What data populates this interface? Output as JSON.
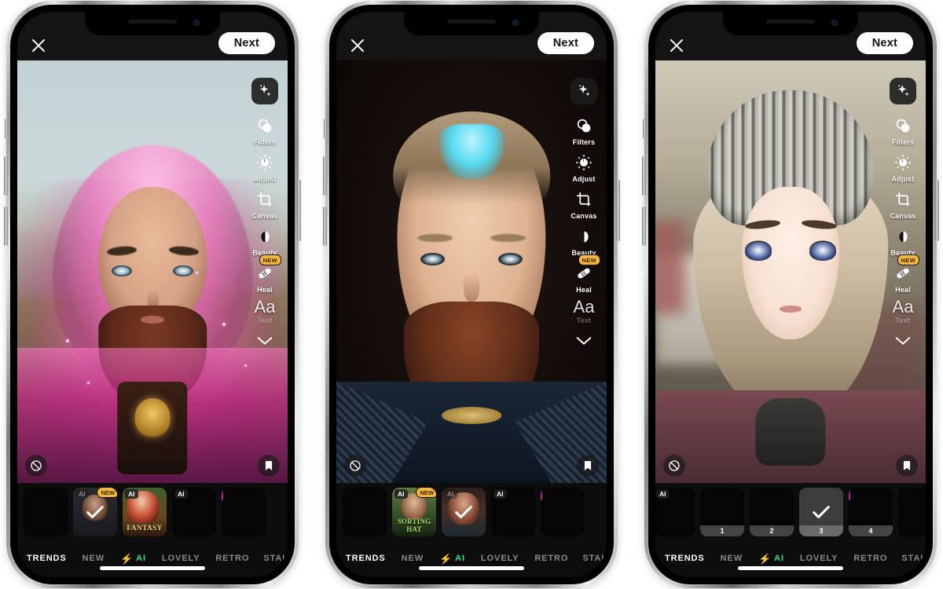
{
  "app": {
    "name": "photo-editor",
    "accent_green": "#2fe08a",
    "badge_yellow": "#f5b63c",
    "topbar": {
      "close_label": "",
      "next_label": "Next"
    },
    "tools": [
      {
        "id": "magic",
        "label": "",
        "icon": "sparkle-icon",
        "badge": ""
      },
      {
        "id": "filters",
        "label": "Filters",
        "icon": "filters-icon",
        "badge": ""
      },
      {
        "id": "adjust",
        "label": "Adjust",
        "icon": "adjust-icon",
        "badge": ""
      },
      {
        "id": "canvas",
        "label": "Canvas",
        "icon": "crop-icon",
        "badge": ""
      },
      {
        "id": "beauty",
        "label": "Beauty",
        "icon": "beauty-icon",
        "badge": ""
      },
      {
        "id": "heal",
        "label": "Heal",
        "icon": "bandage-icon",
        "badge": "NEW"
      },
      {
        "id": "text",
        "label": "Text",
        "icon": "text-aa-icon",
        "badge": "",
        "glyph": "Aa"
      }
    ],
    "collapse_label": "",
    "photo_actions": {
      "none_label": "no-effect",
      "save_label": "bookmark"
    },
    "tabs": [
      {
        "label": "TRENDS",
        "active": true,
        "style": "plain"
      },
      {
        "label": "NEW",
        "active": false,
        "style": "plain"
      },
      {
        "label": "AI",
        "active": false,
        "style": "ai"
      },
      {
        "label": "LOVELY",
        "active": false,
        "style": "plain"
      },
      {
        "label": "RETRO",
        "active": false,
        "style": "plain"
      },
      {
        "label": "STAI",
        "active": false,
        "style": "plain"
      }
    ],
    "search_icon": "search-icon"
  },
  "phones": [
    {
      "id": "phone-1",
      "photo": "wizard-pink-hood-portrait",
      "thumbs": [
        {
          "tag": "",
          "badge": "",
          "selected": false,
          "art": "blank",
          "title": "",
          "num": ""
        },
        {
          "tag": "AI",
          "badge": "NEW",
          "selected": true,
          "art": "boy",
          "title": "",
          "num": "",
          "tag_faded": true
        },
        {
          "tag": "AI",
          "badge": "",
          "selected": false,
          "art": "fantasy",
          "title": "FANTASY",
          "num": ""
        },
        {
          "tag": "AI",
          "badge": "",
          "selected": false,
          "art": "blank",
          "title": "",
          "num": ""
        },
        {
          "tag": "",
          "badge": "",
          "selected": false,
          "art": "blank",
          "title": "",
          "num": "",
          "instagram": true
        }
      ]
    },
    {
      "id": "phone-2",
      "photo": "bearded-man-dark-portrait",
      "thumbs": [
        {
          "tag": "",
          "badge": "",
          "selected": false,
          "art": "blank",
          "title": "",
          "num": ""
        },
        {
          "tag": "AI",
          "badge": "NEW",
          "selected": false,
          "art": "sorting",
          "title": "SORTING HAT",
          "num": ""
        },
        {
          "tag": "AI",
          "badge": "",
          "selected": true,
          "art": "dark-girl",
          "title": "",
          "num": "",
          "tag_faded": true
        },
        {
          "tag": "AI",
          "badge": "",
          "selected": false,
          "art": "blank",
          "title": "",
          "num": ""
        },
        {
          "tag": "",
          "badge": "",
          "selected": false,
          "art": "blank",
          "title": "",
          "num": "",
          "instagram": true
        }
      ]
    },
    {
      "id": "phone-3",
      "photo": "anime-girl-beanie-portrait",
      "thumbs": [
        {
          "tag": "AI",
          "badge": "",
          "selected": false,
          "art": "blank",
          "title": "",
          "num": ""
        },
        {
          "tag": "",
          "badge": "",
          "selected": false,
          "art": "blank",
          "title": "",
          "num": "1"
        },
        {
          "tag": "",
          "badge": "",
          "selected": false,
          "art": "blank",
          "title": "",
          "num": "2"
        },
        {
          "tag": "",
          "badge": "",
          "selected": true,
          "art": "blank",
          "title": "",
          "num": "3"
        },
        {
          "tag": "",
          "badge": "",
          "selected": false,
          "art": "blank",
          "title": "",
          "num": "4",
          "instagram": true
        }
      ]
    }
  ]
}
